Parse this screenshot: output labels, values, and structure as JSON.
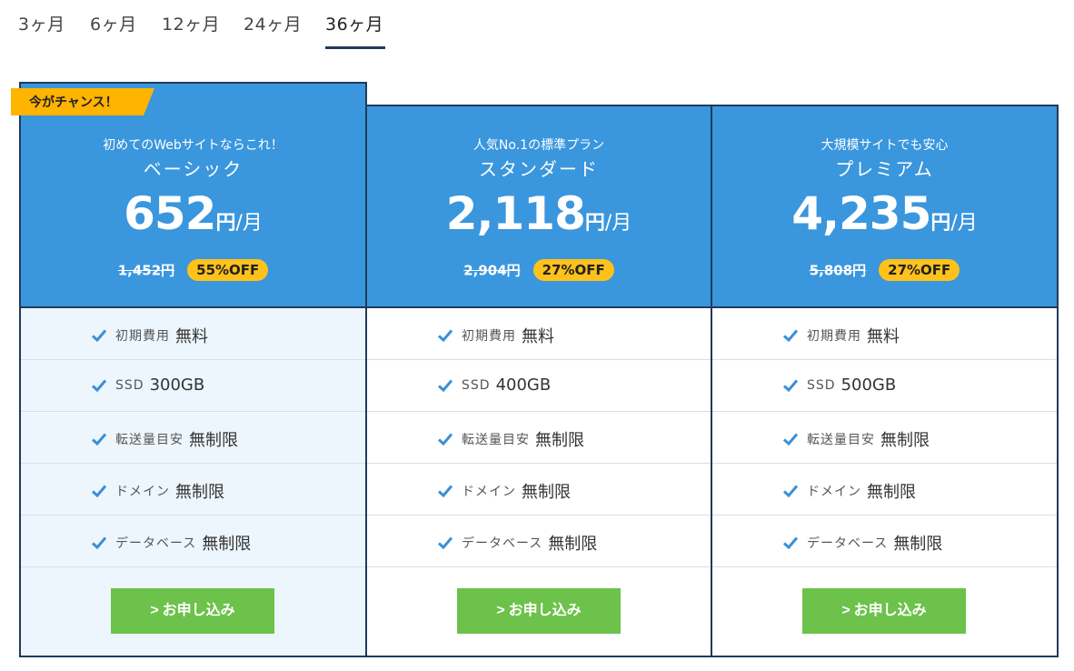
{
  "tabs": [
    {
      "label": "3ヶ月"
    },
    {
      "label": "6ヶ月"
    },
    {
      "label": "12ヶ月"
    },
    {
      "label": "24ヶ月"
    },
    {
      "label": "36ヶ月",
      "active": true
    }
  ],
  "ribbon": {
    "label": "今がチャンス！"
  },
  "plans": [
    {
      "tagline": "初めてのWebサイトならこれ！",
      "name": "ベーシック",
      "price": "652",
      "price_unit": "円",
      "price_per": "/月",
      "original_price": "1,452円",
      "discount": "55%OFF",
      "features": [
        {
          "label": "初期費用",
          "value": "無料"
        },
        {
          "label": "SSD",
          "value": "300GB"
        },
        {
          "label": "転送量目安",
          "value": "無制限"
        },
        {
          "label": "ドメイン",
          "value": "無制限"
        },
        {
          "label": "データベース",
          "value": "無制限"
        }
      ],
      "button": "お申し込み"
    },
    {
      "tagline": "人気No.1の標準プラン",
      "name": "スタンダード",
      "price": "2,118",
      "price_unit": "円",
      "price_per": "/月",
      "original_price": "2,904円",
      "discount": "27%OFF",
      "features": [
        {
          "label": "初期費用",
          "value": "無料"
        },
        {
          "label": "SSD",
          "value": "400GB"
        },
        {
          "label": "転送量目安",
          "value": "無制限"
        },
        {
          "label": "ドメイン",
          "value": "無制限"
        },
        {
          "label": "データベース",
          "value": "無制限"
        }
      ],
      "button": "お申し込み"
    },
    {
      "tagline": "大規模サイトでも安心",
      "name": "プレミアム",
      "price": "4,235",
      "price_unit": "円",
      "price_per": "/月",
      "original_price": "5,808円",
      "discount": "27%OFF",
      "features": [
        {
          "label": "初期費用",
          "value": "無料"
        },
        {
          "label": "SSD",
          "value": "500GB"
        },
        {
          "label": "転送量目安",
          "value": "無制限"
        },
        {
          "label": "ドメイン",
          "value": "無制限"
        },
        {
          "label": "データベース",
          "value": "無制限"
        }
      ],
      "button": "お申し込み"
    }
  ],
  "colors": {
    "header_blue": "#3a96dd",
    "border_navy": "#1f3b5a",
    "badge_yellow": "#ffc21a",
    "button_green": "#6cc24a",
    "highlight_bg": "#edf6fd",
    "check_blue": "#3a8fd8"
  },
  "icons": {
    "check": "check-icon",
    "chevron": "chevron-right-icon"
  }
}
